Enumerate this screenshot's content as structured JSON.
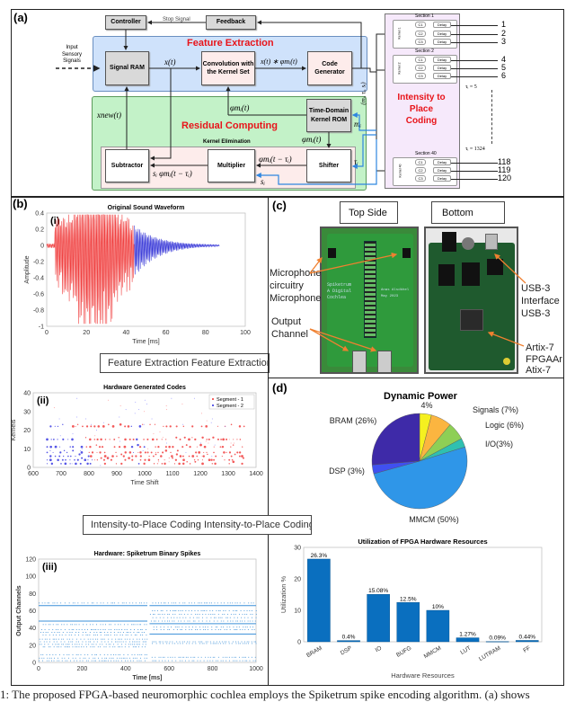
{
  "caption": "1: The proposed FPGA-based neuromorphic cochlea employs the Spiketrum spike encoding algorithm. (a) shows",
  "panel_a": {
    "label": "(a)",
    "controller": "Controller",
    "feedback": "Feedback",
    "stop_signal": "Stop Signal",
    "input_label": "Input Sensory Signals",
    "feature_extraction": "Feature Extraction",
    "signal_ram": "Signal RAM",
    "convolution": "Convolution with the Kernel Set",
    "code_generator": "Code Generator",
    "x_t": "x(t)",
    "conv_out": "x(t) ∗ φmᵢ(t)",
    "residual_computing": "Residual Computing",
    "kernel_rom": "Time-Domain Kernel ROM",
    "phi_t": "φmᵢ(t)",
    "phi_t2": "φmᵢ(t)",
    "x_new": "xnew(t)",
    "m_i": "mᵢ",
    "tau_i": "τᵢ",
    "s_i": "sᵢ",
    "kernel_elimination": "Kernel Elimination",
    "subtractor": "Subtractor",
    "multiplier": "Multiplier",
    "shifter": "Shifter",
    "phi_shift": "φmᵢ(t − τᵢ)",
    "s_phi_shift": "sᵢ φmᵢ(t − τᵢ)",
    "tuple": "(mᵢ, τᵢ, sᵢ)",
    "intensity": "Intensity to Place Coding",
    "sections": [
      {
        "title": "Section 1",
        "kernel": "Kernel 1",
        "outputs": [
          "1",
          "2",
          "3"
        ]
      },
      {
        "title": "Section 2",
        "kernel": "Kernel 2",
        "outputs": [
          "4",
          "5",
          "6"
        ]
      },
      {
        "title": "Section 40",
        "kernel": "Kernel 40",
        "outputs": [
          "118",
          "119",
          "120"
        ]
      }
    ],
    "comparators": [
      "C1",
      "C2",
      "C3"
    ],
    "delay": "Delay",
    "tau_5": "τᵢ = 5",
    "tau_1324": "τᵢ = 1324",
    "colors": {
      "feature": "#cfe2fb",
      "residual": "#c3f2c8",
      "intensity": "#f6e9fb",
      "title_red": "#e8141a",
      "feedback_arrow": "#2f86e0"
    }
  },
  "panel_b": {
    "label": "(b)",
    "flow1": "Feature Extraction Feature Extraction",
    "flow2": "Intensity-to-Place Coding Intensity-to-Place Coding"
  },
  "panel_c": {
    "label": "(c)",
    "top_side": "Top Side",
    "bottom": "Bottom",
    "mic_label": [
      "Microphone",
      "circuitry",
      "Microphone"
    ],
    "output_label": [
      "Output",
      "Channel"
    ],
    "usb_label": [
      "USB-3",
      "Interface",
      "USB-3"
    ],
    "fpga_label": [
      "Artix-7",
      "FPGAAr",
      "Atix-7"
    ],
    "board_text_top": [
      "Spiketrum",
      "A Digital",
      "Cochlea",
      "Anas Alsdkhel",
      "May 2023"
    ]
  },
  "panel_d": {
    "label": "(d)"
  },
  "chart_data": [
    {
      "type": "line",
      "panel_tag": "(i)",
      "title": "Original Sound Waveform",
      "xlabel": "Time [ms]",
      "ylabel": "Amplitude",
      "xlim": [
        0,
        100
      ],
      "ylim": [
        -1,
        0.4
      ],
      "xticks": [
        "0",
        "20",
        "40",
        "60",
        "80",
        "100"
      ],
      "yticks": [
        "0.4",
        "0.2",
        "0",
        "-0.2",
        "-0.4",
        "-0.6",
        "-0.8",
        "-1"
      ],
      "series_colors": [
        "#f04040",
        "#3a3ad8"
      ],
      "segment_split_ms": 44,
      "signal_end_ms": 87
    },
    {
      "type": "scatter",
      "panel_tag": "(ii)",
      "title": "Hardware Generated Codes",
      "xlabel": "Time Shift",
      "ylabel": "Kernels",
      "xlim": [
        600,
        1400
      ],
      "ylim": [
        0,
        40
      ],
      "xticks": [
        "600",
        "700",
        "800",
        "900",
        "1000",
        "1100",
        "1200",
        "1300",
        "1400"
      ],
      "yticks": [
        "40",
        "30",
        "20",
        "10",
        "0"
      ],
      "series": [
        {
          "name": "Segment - 1",
          "color": "#f03030"
        },
        {
          "name": "Segment - 2",
          "color": "#2a2ae0"
        }
      ],
      "legend": "top-right"
    },
    {
      "type": "scatter",
      "panel_tag": "(iii)",
      "title": "Hardware: Spiketrum Binary Spikes",
      "xlabel": "Time [ms]",
      "ylabel": "Output Channels",
      "xlim": [
        0,
        1000
      ],
      "ylim": [
        0,
        120
      ],
      "xticks": [
        "0",
        "200",
        "400",
        "600",
        "800",
        "1000"
      ],
      "yticks": [
        "120",
        "100",
        "80",
        "60",
        "40",
        "20",
        "0"
      ],
      "color": "#3a8fd8"
    },
    {
      "type": "pie",
      "title": "Dynamic Power",
      "slices": [
        {
          "label": "4%",
          "value": 4,
          "color": "#f5f020"
        },
        {
          "label": "Signals (7%)",
          "value": 7,
          "color": "#fbb540"
        },
        {
          "label": "Logic (6%)",
          "value": 6,
          "color": "#8ecf55"
        },
        {
          "label": "I/O(3%)",
          "value": 3,
          "color": "#2fc0b0"
        },
        {
          "label": "MMCM (50%)",
          "value": 50,
          "color": "#2f96e8"
        },
        {
          "label": "DSP (3%)",
          "value": 3,
          "color": "#4050f0"
        },
        {
          "label": "BRAM (26%)",
          "value": 26,
          "color": "#3e2aa8"
        }
      ]
    },
    {
      "type": "bar",
      "title": "Utilization of FPGA Hardware Resources",
      "xlabel": "Hardware Resources",
      "ylabel": "Utilization %",
      "ylim": [
        0,
        30
      ],
      "yticks": [
        "30",
        "20",
        "10",
        "0"
      ],
      "categories": [
        "BRAM",
        "DSP",
        "IO",
        "BUFG",
        "MMCM",
        "LUT",
        "LUTRAM",
        "FF"
      ],
      "values": [
        26.3,
        0.4,
        15.08,
        12.5,
        10,
        1.27,
        0.09,
        0.44
      ],
      "value_labels": [
        "26.3%",
        "0.4%",
        "15.08%",
        "12.5%",
        "10%",
        "1.27%",
        "0.09%",
        "0.44%"
      ],
      "color": "#0a6fbf"
    }
  ]
}
